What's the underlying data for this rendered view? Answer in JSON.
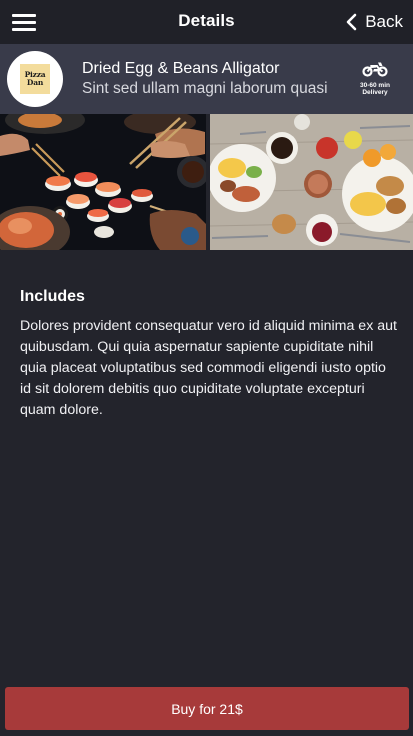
{
  "topbar": {
    "title": "Details",
    "back_label": "Back",
    "menu_icon": "hamburger-menu-icon",
    "back_icon": "chevron-left-icon"
  },
  "restaurant": {
    "logo_text": "Pizza Dan",
    "name": "Dried Egg & Beans Alligator",
    "description": "Sint sed ullam magni laborum quasi",
    "delivery_icon": "motorcycle-icon",
    "delivery_time": "30-60 min",
    "delivery_label": "Delivery"
  },
  "photos": [
    {
      "subject": "sushi platter"
    },
    {
      "subject": "breakfast spread"
    }
  ],
  "includes": {
    "title": "Includes",
    "body": "Dolores provident consequatur vero id aliquid minima ex aut quibusdam. Qui quia aspernatur sapiente cupiditate nihil quia placeat voluptatibus sed commodi eligendi iusto optio id sit dolorem debitis quo cupiditate voluptate excepturi quam dolore."
  },
  "buy": {
    "label": "Buy for 21$"
  },
  "colors": {
    "background": "#23242c",
    "header_band": "#393b4a",
    "buy_button": "#a73a3a"
  }
}
